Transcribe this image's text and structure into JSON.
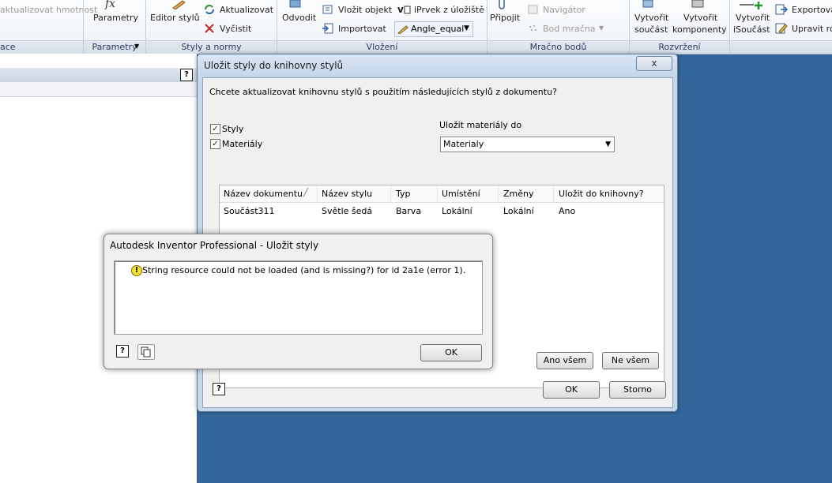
{
  "ribbon": {
    "items": {
      "hmotnost": "aktualizovat hmotnost",
      "parametry": "Parametry",
      "editor_stylu": "Editor stylů",
      "aktualizovat": "Aktualizovat",
      "vycistit": "Vyčistit",
      "odvodit": "Odvodit",
      "vlozit_objekt": "Vložit objekt",
      "importovat": "Importovat",
      "iprvek": "iPrvek z úložiště",
      "angle_equal": "Angle_equal",
      "pripojit": "Připojit",
      "navigator": "Navigátor",
      "bod_mracna": "Bod mračna",
      "vytvorit_soucast_1": "Vytvořit",
      "vytvorit_soucast_2": "součást",
      "vytvorit_komponenty_1": "Vytvořit",
      "vytvorit_komponenty_2": "komponenty",
      "vytvorit_isoucast_1": "Vytvořit",
      "vytvorit_isoucast_2": "iSoučást",
      "exportovat": "Exportova",
      "upravit": "Upravit ro"
    },
    "groups": {
      "ace": "ace",
      "parametry": "Parametry",
      "styly": "Styly a normy",
      "vlozeni": "Vložení",
      "mracno": "Mračno bodů",
      "rozvrzeni": "Rozvržení"
    }
  },
  "main_dialog": {
    "title": "Uložit styly do knihovny stylů",
    "close": "x",
    "prompt": "Chcete aktualizovat knihovnu stylů s použitím následujících stylů z dokumentu?",
    "chk_styly": "Styly",
    "chk_materialy": "Materiály",
    "save_materials_label": "Uložit materiály do",
    "save_materials_value": "Materialy",
    "columns": [
      "Název dokumentu",
      "Název stylu",
      "Typ",
      "Umístění",
      "Změny",
      "Uložit do knihovny?"
    ],
    "rows": [
      [
        "Součást311",
        "Světle šedá",
        "Barva",
        "Lokální",
        "Lokální",
        "Ano"
      ]
    ],
    "yes_all": "Ano všem",
    "no_all": "Ne všem",
    "ok": "OK",
    "cancel": "Storno",
    "help": "?"
  },
  "error_dialog": {
    "title": "Autodesk Inventor Professional - Uložit styly",
    "message": "String resource could not be loaded (and is missing?) for id 2a1e (error 1).",
    "warn_glyph": "!",
    "ok": "OK",
    "help": "?"
  }
}
